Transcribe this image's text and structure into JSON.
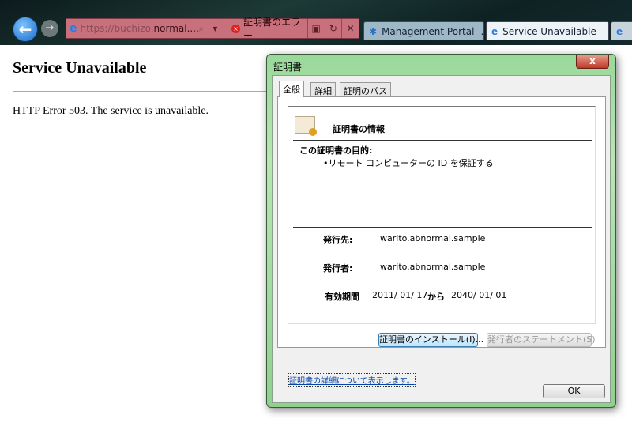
{
  "browser": {
    "url_prefix": "https://buchizo.",
    "url_domain": "normal....",
    "cert_error": "証明書のエラー",
    "tabs": [
      {
        "label": "Management Portal -..."
      },
      {
        "label": "Service Unavailable"
      }
    ],
    "close_tab": "x"
  },
  "page": {
    "title": "Service Unavailable",
    "message": "HTTP Error 503. The service is unavailable."
  },
  "dialog": {
    "title": "証明書",
    "close": "x",
    "tabs": [
      "全般",
      "詳細",
      "証明のパス"
    ],
    "heading": "証明書の情報",
    "purpose_label": "この証明書の目的:",
    "purpose_item": "•リモート コンピューターの ID を保証する",
    "issued_to_label": "発行先:",
    "issued_to": "warito.abnormal.sample",
    "issued_by_label": "発行者:",
    "issued_by": "warito.abnormal.sample",
    "validity_label": "有効期間",
    "valid_from": "2011/ 01/ 17",
    "from_word": "から",
    "valid_to": "2040/ 01/ 01",
    "install_button": "証明書のインストール(I)...",
    "statement_button": "発行者のステートメント(S)",
    "details_link": "証明書の詳細について表示します。",
    "ok_button": "OK"
  }
}
